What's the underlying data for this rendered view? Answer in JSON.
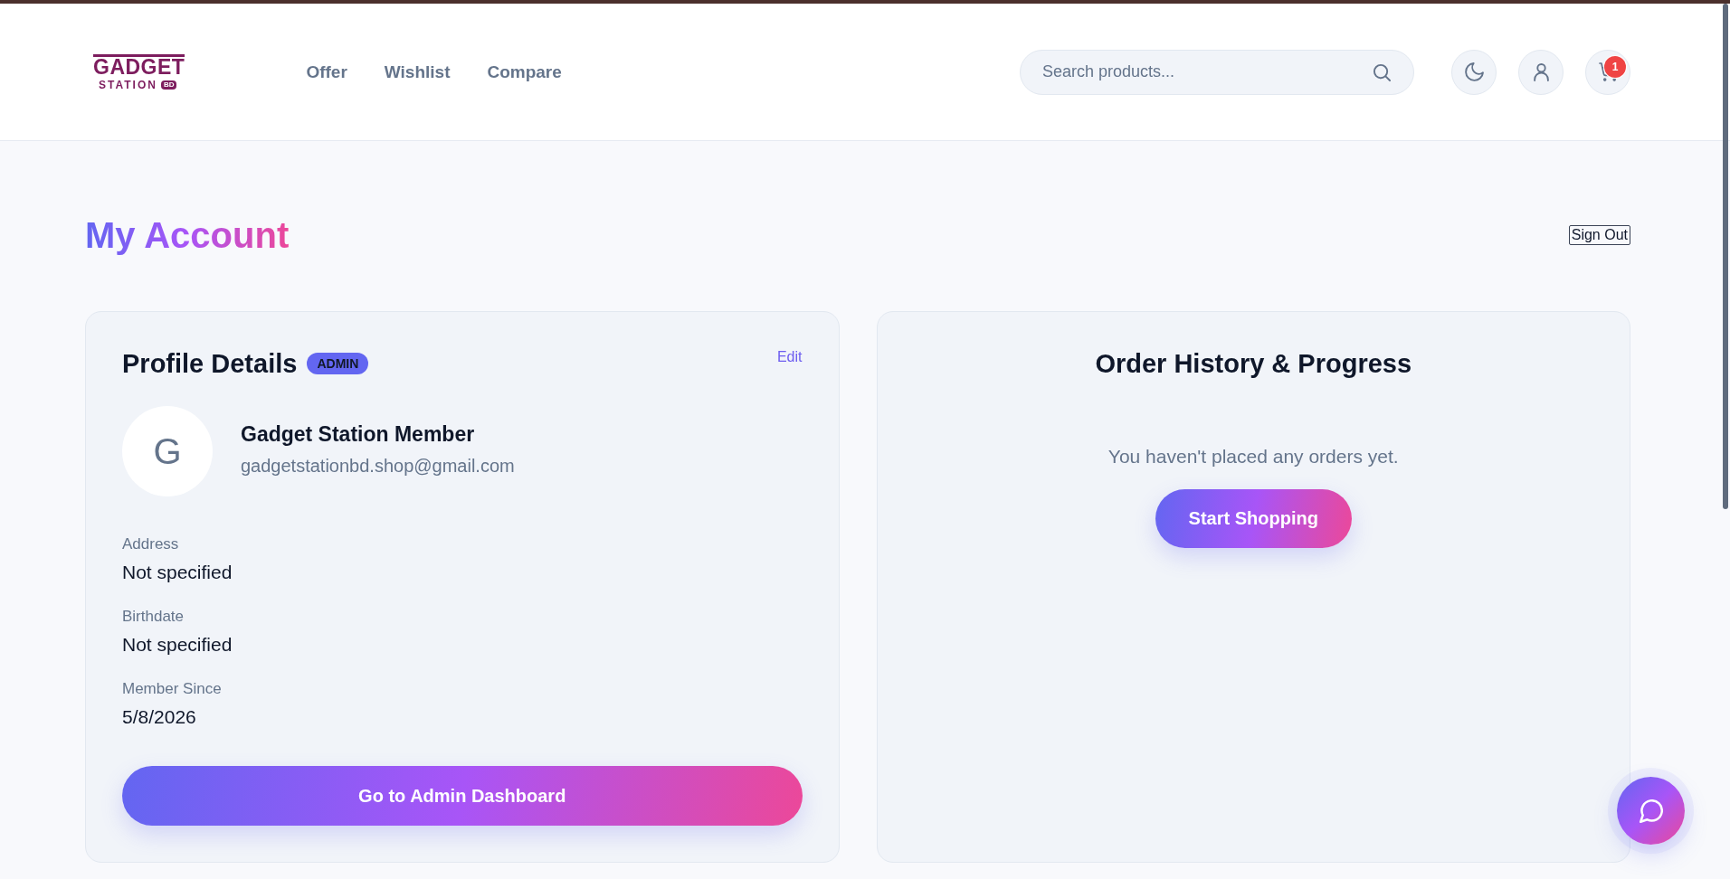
{
  "header": {
    "logo": {
      "wordmark": "GADGET",
      "tagline": "STATION",
      "badge": "BD"
    },
    "nav": [
      "Offer",
      "Wishlist",
      "Compare"
    ],
    "search": {
      "placeholder": "Search products..."
    },
    "cart_count": "1"
  },
  "page": {
    "title": "My Account",
    "sign_out": "Sign Out"
  },
  "profile": {
    "title": "Profile Details",
    "role": "ADMIN",
    "edit": "Edit",
    "avatar_initial": "G",
    "name": "Gadget Station Member",
    "email": "gadgetstationbd.shop@gmail.com",
    "fields": [
      {
        "label": "Address",
        "value": "Not specified"
      },
      {
        "label": "Birthdate",
        "value": "Not specified"
      },
      {
        "label": "Member Since",
        "value": "5/8/2026"
      }
    ],
    "dashboard_button": "Go to Admin Dashboard"
  },
  "orders": {
    "title": "Order History & Progress",
    "empty_message": "You haven't placed any orders yet.",
    "shop_button": "Start Shopping"
  }
}
